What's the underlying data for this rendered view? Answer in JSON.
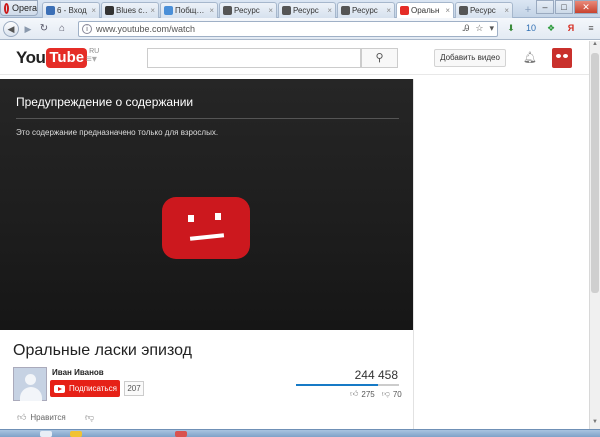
{
  "browser": {
    "menu_label": "Opera",
    "tabs": [
      {
        "label": "6 - Вход",
        "favicon_color": "#3b6fb6"
      },
      {
        "label": "Blues c…",
        "favicon_color": "#333333"
      },
      {
        "label": "Побщ…",
        "favicon_color": "#4a8fd8"
      },
      {
        "label": "Ресурс",
        "favicon_color": "#555555"
      },
      {
        "label": "Ресурс",
        "favicon_color": "#555555"
      },
      {
        "label": "Ресурс",
        "favicon_color": "#555555"
      },
      {
        "label": "Оральн",
        "favicon_color": "#e52d27",
        "active": true
      },
      {
        "label": "Ресурс",
        "favicon_color": "#555555"
      }
    ],
    "url": "www.youtube.com/watch",
    "ext_badges": [
      "10",
      "Я"
    ]
  },
  "youtube": {
    "logo_you": "You",
    "logo_tube": "Tube",
    "logo_region": "RU",
    "upload_label": "Добавить видео",
    "warning": {
      "title": "Предупреждение о содержании",
      "text": "Это содержание предназначено только для взрослых."
    },
    "video": {
      "title": "Оральные ласки эпизод",
      "channel": "Иван Иванов",
      "subscribe_label": "Подписаться",
      "subscriber_count": "207",
      "views": "244 458",
      "likes": "275",
      "dislikes": "70",
      "like_ratio": 0.797,
      "like_action_label": "Нравится"
    }
  },
  "colors": {
    "brand_red": "#e52d27",
    "subscribe_red": "#e62117",
    "like_bar_blue": "#167ac6"
  }
}
